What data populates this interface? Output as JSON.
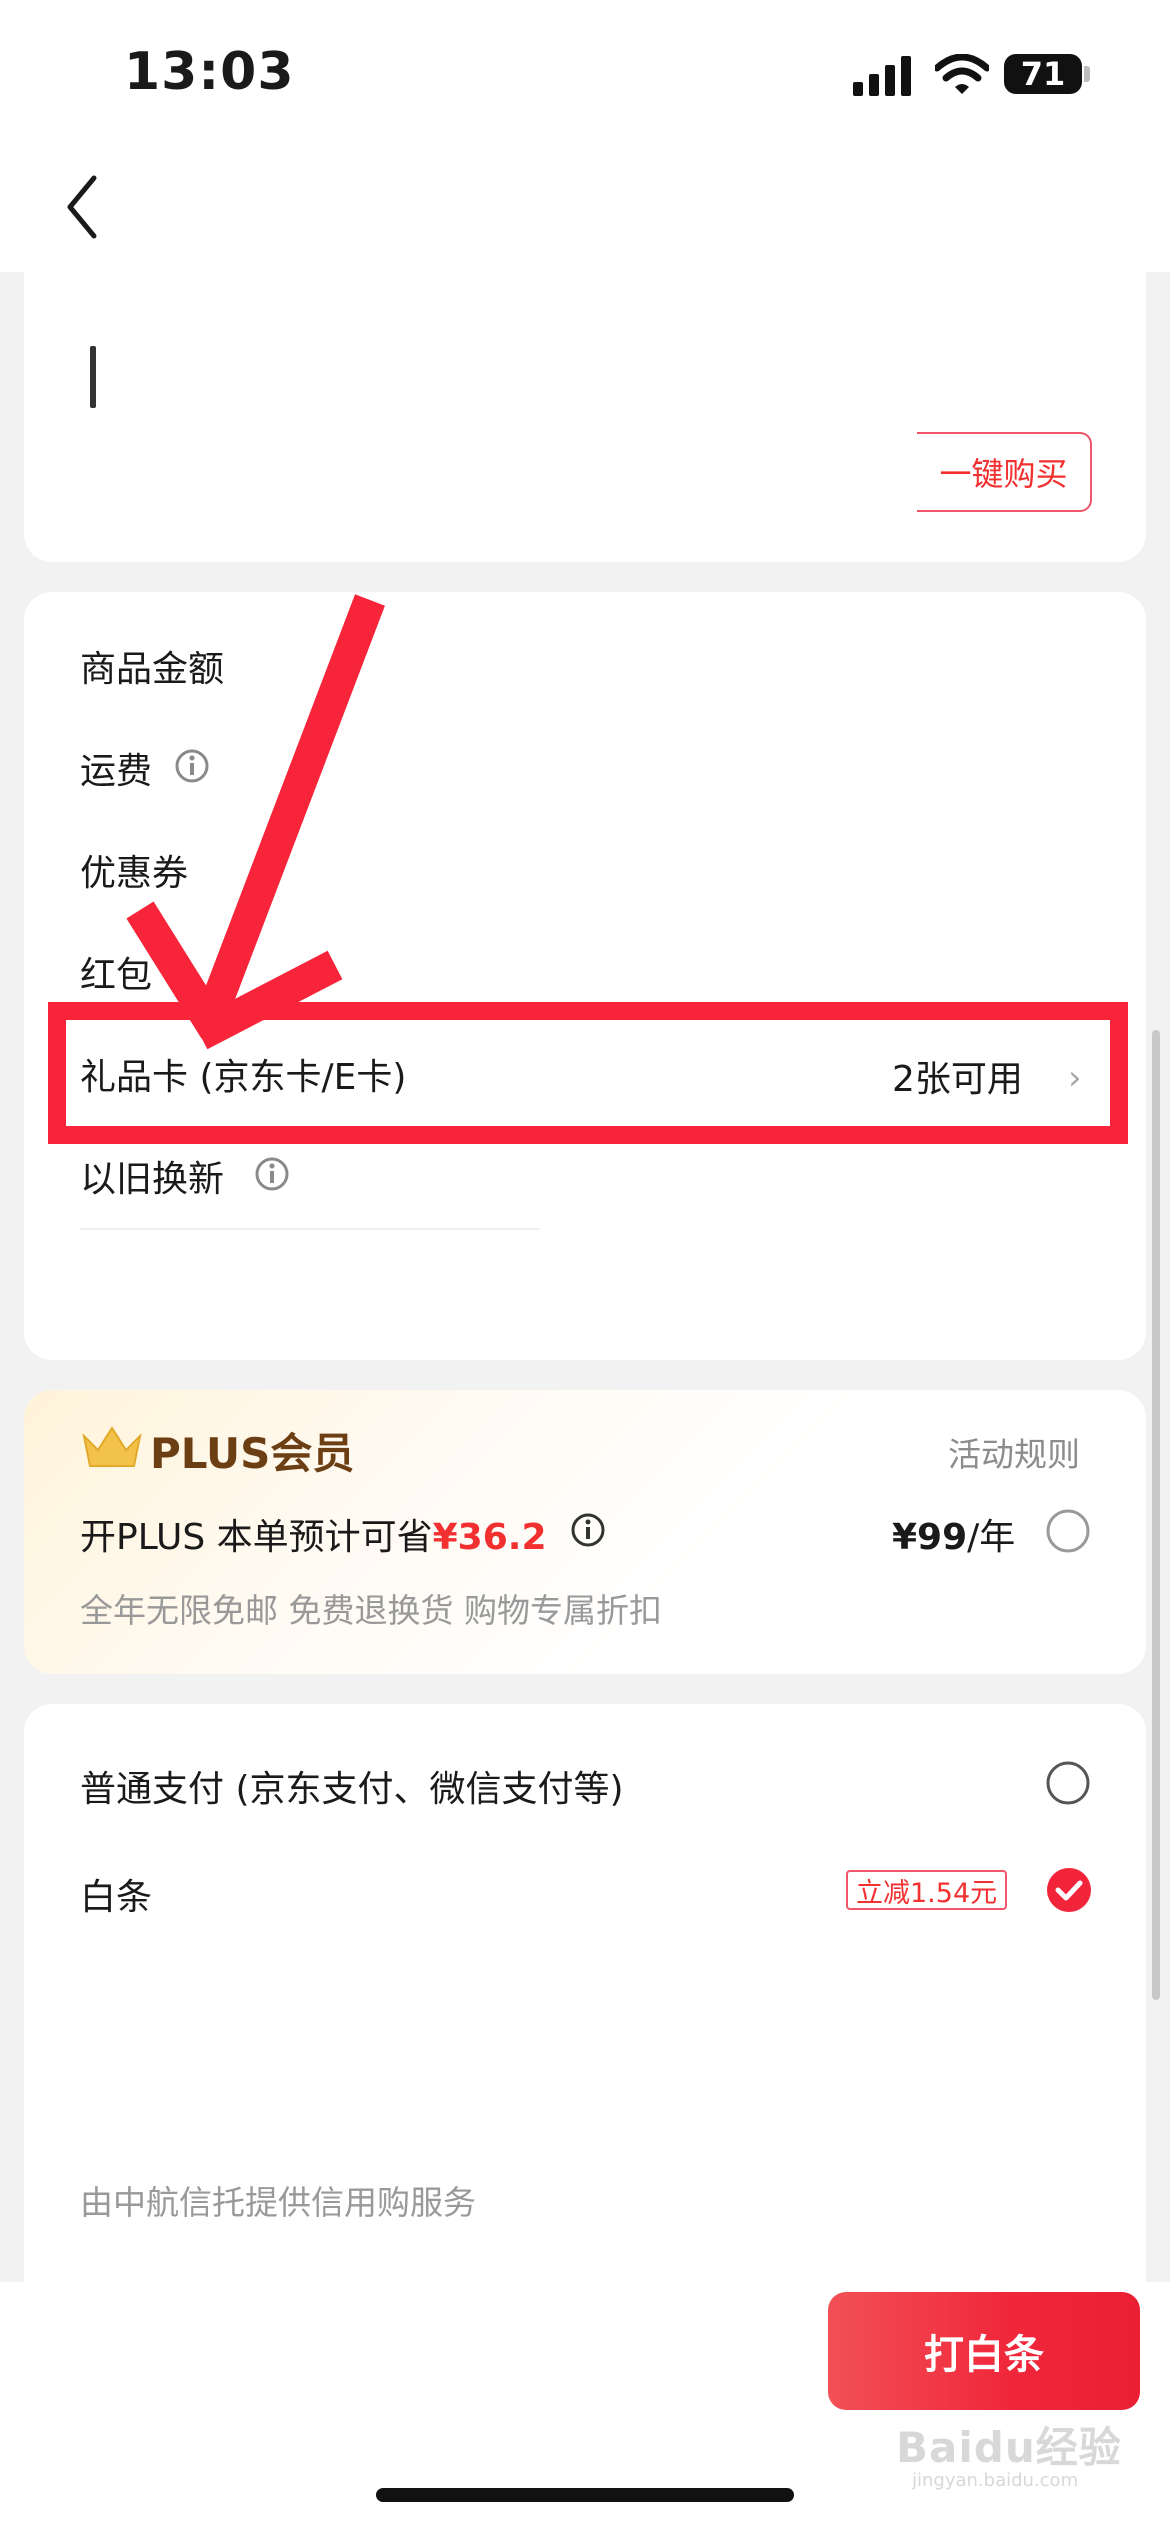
{
  "status_bar": {
    "time": "13:03",
    "battery": "71"
  },
  "top_card": {
    "one_click_buy": "一键购买"
  },
  "price_rows": [
    {
      "label": "商品金额"
    },
    {
      "label": "运费"
    },
    {
      "label": "优惠券"
    },
    {
      "label": "红包"
    },
    {
      "label": "礼品卡 (京东卡/E卡)",
      "value": "2张可用"
    },
    {
      "label": "以旧换新"
    }
  ],
  "plus": {
    "title": "PLUS会员",
    "rules": "活动规则",
    "line_prefix": "开PLUS 本单预计可省",
    "saving": "¥36.2",
    "price": "¥99",
    "price_unit": "/年",
    "benefits": "全年无限免邮 免费退换货 购物专属折扣"
  },
  "payment": {
    "normal": "普通支付 (京东支付、微信支付等)",
    "baitiao": "白条",
    "baitiao_badge": "立减1.54元",
    "credit_note": "由中航信托提供信用购服务"
  },
  "bottom": {
    "pay_button": "打白条"
  },
  "watermark": {
    "brand": "Baidu经验",
    "url": "jingyan.baidu.com"
  },
  "colors": {
    "accent_red": "#f23030",
    "annotation_red": "#f7243a",
    "plus_brown": "#6b3e14"
  }
}
